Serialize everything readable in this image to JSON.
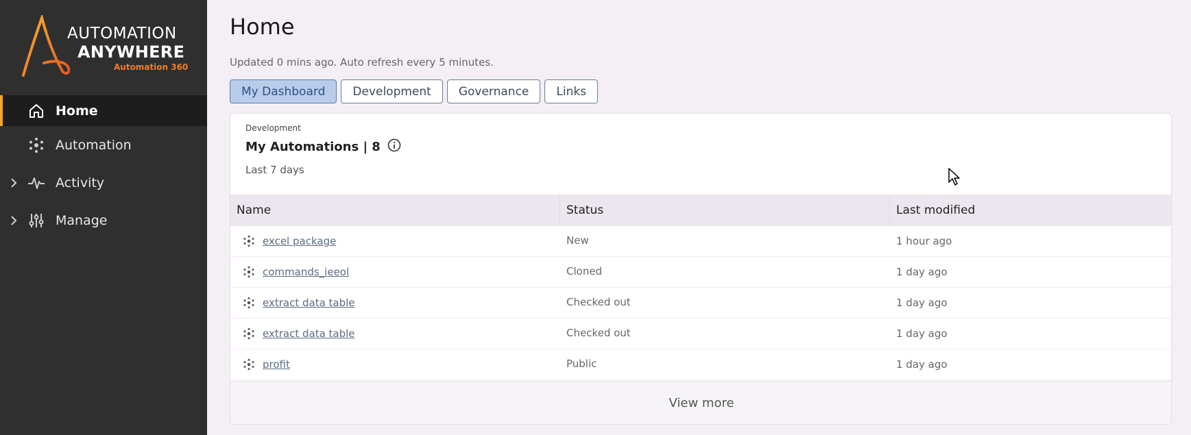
{
  "brand": {
    "line1": "AUTOMATION",
    "line2": "ANYWHERE",
    "line3": "Automation 360",
    "accent": "#f5a623",
    "orange": "#f07c2a"
  },
  "sidebar": {
    "items": [
      {
        "label": "Home",
        "icon": "home-icon",
        "active": true
      },
      {
        "label": "Automation",
        "icon": "bot-icon",
        "active": false
      },
      {
        "label": "Activity",
        "icon": "pulse-icon",
        "active": false,
        "expandable": true
      },
      {
        "label": "Manage",
        "icon": "sliders-icon",
        "active": false,
        "expandable": true
      }
    ]
  },
  "page": {
    "title": "Home",
    "updated": "Updated 0 mins ago. Auto refresh every 5 minutes."
  },
  "tabs": [
    {
      "label": "My Dashboard",
      "selected": true
    },
    {
      "label": "Development",
      "selected": false
    },
    {
      "label": "Governance",
      "selected": false
    },
    {
      "label": "Links",
      "selected": false
    }
  ],
  "card": {
    "section": "Development",
    "heading": "My Automations | 8",
    "range": "Last 7 days",
    "columns": [
      "Name",
      "Status",
      "Last modified"
    ],
    "rows": [
      {
        "name": "excel package",
        "status": "New",
        "modified": "1 hour ago"
      },
      {
        "name": "commands_ieeol",
        "status": "Cloned",
        "modified": "1 day ago"
      },
      {
        "name": "extract data table",
        "status": "Checked out",
        "modified": "1 day ago"
      },
      {
        "name": "extract data table",
        "status": "Checked out",
        "modified": "1 day ago"
      },
      {
        "name": "profit",
        "status": "Public",
        "modified": "1 day ago"
      }
    ],
    "view_more": "View more"
  }
}
